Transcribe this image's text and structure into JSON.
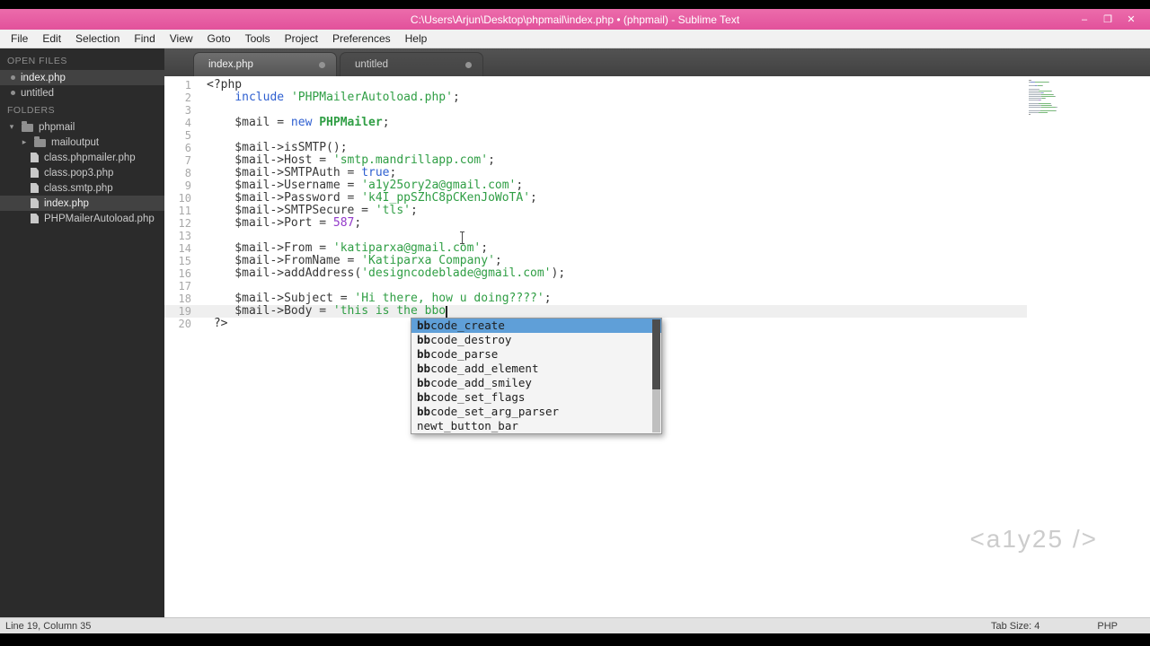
{
  "window": {
    "title": "C:\\Users\\Arjun\\Desktop\\phpmail\\index.php • (phpmail) - Sublime Text"
  },
  "icons": {
    "window_minimize": "–",
    "window_maximize": "❐",
    "window_close": "✕",
    "folder_expanded_arrow": "▾",
    "folder_collapsed_arrow": "▸"
  },
  "menu": {
    "items": [
      "File",
      "Edit",
      "Selection",
      "Find",
      "View",
      "Goto",
      "Tools",
      "Project",
      "Preferences",
      "Help"
    ]
  },
  "sidebar": {
    "open_files_label": "OPEN FILES",
    "open_files": [
      {
        "label": "index.php",
        "selected": true,
        "modified": true
      },
      {
        "label": "untitled",
        "selected": false,
        "modified": true
      }
    ],
    "folders_label": "FOLDERS",
    "tree": [
      {
        "label": "phpmail",
        "type": "folder-open",
        "depth": 0,
        "selected": false
      },
      {
        "label": "mailoutput",
        "type": "folder",
        "depth": 1,
        "selected": false
      },
      {
        "label": "class.phpmailer.php",
        "type": "file",
        "depth": 1,
        "selected": false
      },
      {
        "label": "class.pop3.php",
        "type": "file",
        "depth": 1,
        "selected": false
      },
      {
        "label": "class.smtp.php",
        "type": "file",
        "depth": 1,
        "selected": false
      },
      {
        "label": "index.php",
        "type": "file",
        "depth": 1,
        "selected": true
      },
      {
        "label": "PHPMailerAutoload.php",
        "type": "file",
        "depth": 1,
        "selected": false
      }
    ]
  },
  "tabs": [
    {
      "label": "index.php",
      "active": true,
      "modified": true
    },
    {
      "label": "untitled",
      "active": false,
      "modified": true
    }
  ],
  "editor": {
    "lines": [
      {
        "num": 1,
        "segments": [
          {
            "t": "<?php",
            "c": "tag"
          }
        ]
      },
      {
        "num": 2,
        "segments": [
          {
            "t": "    ",
            "c": "p"
          },
          {
            "t": "include",
            "c": "kw"
          },
          {
            "t": " ",
            "c": "p"
          },
          {
            "t": "'PHPMailerAutoload.php'",
            "c": "str"
          },
          {
            "t": ";",
            "c": "p"
          }
        ]
      },
      {
        "num": 3,
        "segments": []
      },
      {
        "num": 4,
        "segments": [
          {
            "t": "    $mail = ",
            "c": "p"
          },
          {
            "t": "new",
            "c": "kw"
          },
          {
            "t": " ",
            "c": "p"
          },
          {
            "t": "PHPMailer",
            "c": "cls"
          },
          {
            "t": ";",
            "c": "p"
          }
        ]
      },
      {
        "num": 5,
        "segments": []
      },
      {
        "num": 6,
        "segments": [
          {
            "t": "    $mail->isSMTP();",
            "c": "p"
          }
        ]
      },
      {
        "num": 7,
        "segments": [
          {
            "t": "    $mail->Host = ",
            "c": "p"
          },
          {
            "t": "'smtp.mandrillapp.com'",
            "c": "str"
          },
          {
            "t": ";",
            "c": "p"
          }
        ]
      },
      {
        "num": 8,
        "segments": [
          {
            "t": "    $mail->SMTPAuth = ",
            "c": "p"
          },
          {
            "t": "true",
            "c": "kw"
          },
          {
            "t": ";",
            "c": "p"
          }
        ]
      },
      {
        "num": 9,
        "segments": [
          {
            "t": "    $mail->Username = ",
            "c": "p"
          },
          {
            "t": "'a1y25ory2a@gmail.com'",
            "c": "str"
          },
          {
            "t": ";",
            "c": "p"
          }
        ]
      },
      {
        "num": 10,
        "segments": [
          {
            "t": "    $mail->Password = ",
            "c": "p"
          },
          {
            "t": "'k4I_ppSZhC8pCKenJoWoTA'",
            "c": "str"
          },
          {
            "t": ";",
            "c": "p"
          }
        ]
      },
      {
        "num": 11,
        "segments": [
          {
            "t": "    $mail->SMTPSecure = ",
            "c": "p"
          },
          {
            "t": "'tls'",
            "c": "str"
          },
          {
            "t": ";",
            "c": "p"
          }
        ]
      },
      {
        "num": 12,
        "segments": [
          {
            "t": "    $mail->Port = ",
            "c": "p"
          },
          {
            "t": "587",
            "c": "num"
          },
          {
            "t": ";",
            "c": "p"
          }
        ]
      },
      {
        "num": 13,
        "segments": []
      },
      {
        "num": 14,
        "segments": [
          {
            "t": "    $mail->From = ",
            "c": "p"
          },
          {
            "t": "'katiparxa@gmail.com'",
            "c": "str"
          },
          {
            "t": ";",
            "c": "p"
          }
        ]
      },
      {
        "num": 15,
        "segments": [
          {
            "t": "    $mail->FromName = ",
            "c": "p"
          },
          {
            "t": "'Katiparxa Company'",
            "c": "str"
          },
          {
            "t": ";",
            "c": "p"
          }
        ]
      },
      {
        "num": 16,
        "segments": [
          {
            "t": "    $mail->addAddress(",
            "c": "p"
          },
          {
            "t": "'designcodeblade@gmail.com'",
            "c": "str"
          },
          {
            "t": ");",
            "c": "p"
          }
        ]
      },
      {
        "num": 17,
        "segments": []
      },
      {
        "num": 18,
        "segments": [
          {
            "t": "    $mail->Subject = ",
            "c": "p"
          },
          {
            "t": "'Hi there, how u doing????'",
            "c": "str"
          },
          {
            "t": ";",
            "c": "p"
          }
        ]
      },
      {
        "num": 19,
        "segments": [
          {
            "t": "    $mail->Body = ",
            "c": "p"
          },
          {
            "t": "'this is the bbo",
            "c": "str"
          }
        ],
        "current": true,
        "cursor": true
      },
      {
        "num": 20,
        "segments": [
          {
            "t": " ?>",
            "c": "tag"
          }
        ]
      }
    ]
  },
  "autocomplete": {
    "items": [
      {
        "bold": "bb",
        "normal": "code_create",
        "selected": true
      },
      {
        "bold": "bb",
        "normal": "code_destroy",
        "selected": false
      },
      {
        "bold": "bb",
        "normal": "code_parse",
        "selected": false
      },
      {
        "bold": "bb",
        "normal": "code_add_element",
        "selected": false
      },
      {
        "bold": "bb",
        "normal": "code_add_smiley",
        "selected": false
      },
      {
        "bold": "bb",
        "normal": "code_set_flags",
        "selected": false
      },
      {
        "bold": "bb",
        "normal": "code_set_arg_parser",
        "selected": false
      },
      {
        "bold": "",
        "normal": "newt_button_bar",
        "selected": false
      }
    ]
  },
  "watermark": "<a1y25 />",
  "status": {
    "left": "Line 19, Column 35",
    "tab_size": "Tab Size: 4",
    "syntax": "PHP"
  }
}
